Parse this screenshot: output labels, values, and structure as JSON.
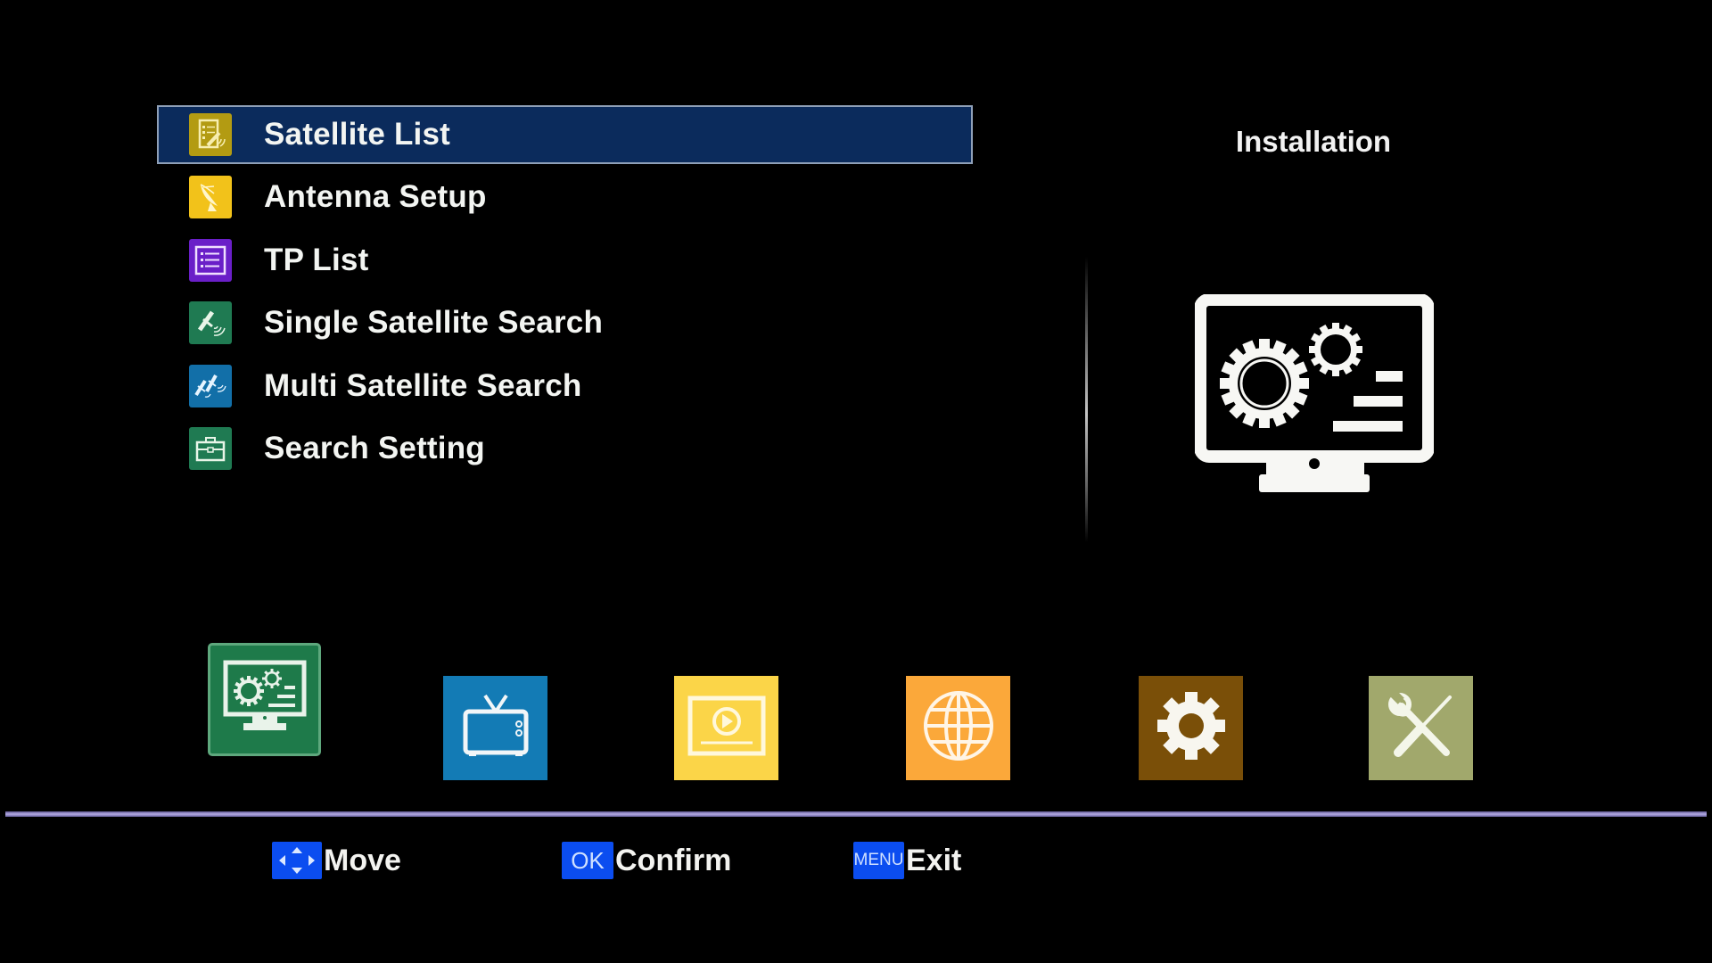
{
  "section": {
    "title": "Installation",
    "preview_icon": "monitor-gears-icon"
  },
  "menu": {
    "selected_index": 0,
    "items": [
      {
        "label": "Satellite List",
        "icon": "satellite-list-icon",
        "color": "#b39b12"
      },
      {
        "label": "Antenna Setup",
        "icon": "satellite-dish-icon",
        "color": "#f2c21a"
      },
      {
        "label": "TP List",
        "icon": "list-icon",
        "color": "#6a1fc8"
      },
      {
        "label": "Single Satellite Search",
        "icon": "satellite-icon",
        "color": "#1f7a52"
      },
      {
        "label": "Multi Satellite Search",
        "icon": "multi-satellite-icon",
        "color": "#126fa8"
      },
      {
        "label": "Search Setting",
        "icon": "toolbox-icon",
        "color": "#1f7a52"
      }
    ]
  },
  "categories": {
    "selected_index": 0,
    "items": [
      {
        "name": "installation",
        "icon": "monitor-gears-icon",
        "color": "#1e7a4a"
      },
      {
        "name": "tv",
        "icon": "tv-icon",
        "color": "#137bb5"
      },
      {
        "name": "media",
        "icon": "video-play-icon",
        "color": "#fbd548"
      },
      {
        "name": "network",
        "icon": "globe-icon",
        "color": "#fba83a"
      },
      {
        "name": "system",
        "icon": "gear-icon",
        "color": "#7a4f08"
      },
      {
        "name": "tools",
        "icon": "tools-icon",
        "color": "#a1a86c"
      }
    ]
  },
  "footer": {
    "move": {
      "key": "move-arrows",
      "label": "Move"
    },
    "confirm": {
      "key": "OK",
      "label": "Confirm"
    },
    "exit": {
      "key": "MENU",
      "label": "Exit"
    }
  }
}
